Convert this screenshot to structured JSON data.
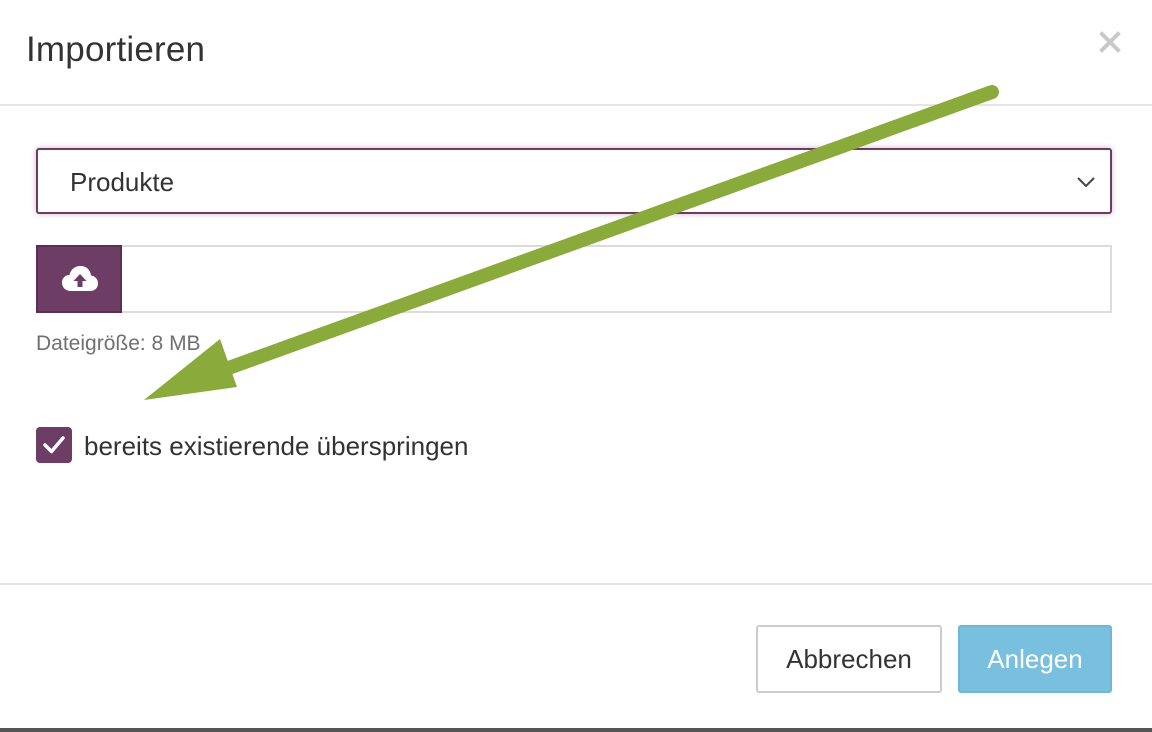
{
  "dialog": {
    "title": "Importieren",
    "close_icon": "close-icon"
  },
  "type_select": {
    "selected": "Produkte",
    "icon": "chevron-down-icon"
  },
  "upload": {
    "icon": "cloud-upload-icon",
    "value": "",
    "size_hint": "Dateigröße: 8 MB"
  },
  "skip_existing": {
    "checked": true,
    "label": "bereits existierende überspringen",
    "icon": "checkmark-icon"
  },
  "footer": {
    "cancel_label": "Abbrechen",
    "submit_label": "Anlegen"
  },
  "annotation": {
    "type": "arrow",
    "color": "#8aab3c"
  },
  "colors": {
    "primary": "#6e3d66",
    "submit": "#79bfde",
    "border": "#dcdcdc"
  }
}
